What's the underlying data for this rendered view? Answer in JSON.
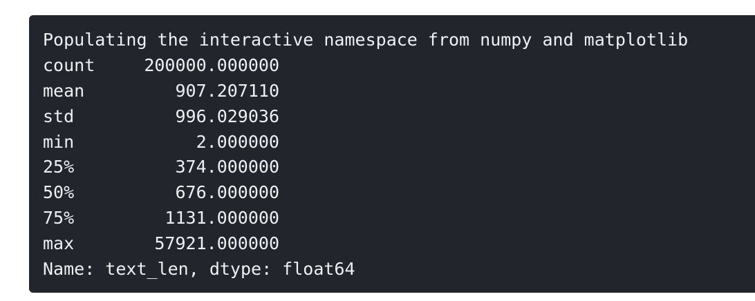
{
  "output": {
    "header_line": "Populating the interactive namespace from numpy and matplotlib",
    "stats": [
      {
        "key": "count",
        "value": "200000.000000"
      },
      {
        "key": "mean",
        "value": "907.207110"
      },
      {
        "key": "std",
        "value": "996.029036"
      },
      {
        "key": "min",
        "value": "2.000000"
      },
      {
        "key": "25%",
        "value": "374.000000"
      },
      {
        "key": "50%",
        "value": "676.000000"
      },
      {
        "key": "75%",
        "value": "1131.000000"
      },
      {
        "key": "max",
        "value": "57921.000000"
      }
    ],
    "footer_line": "Name: text_len, dtype: float64"
  }
}
